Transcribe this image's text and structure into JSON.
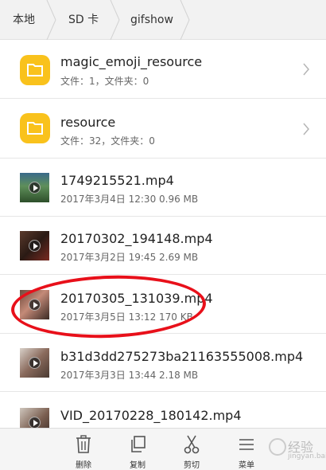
{
  "breadcrumb": {
    "items": [
      "本地",
      "SD 卡",
      "gifshow"
    ]
  },
  "files": [
    {
      "kind": "folder",
      "name": "magic_emoji_resource",
      "meta": "文件：1，文件夹：0"
    },
    {
      "kind": "folder",
      "name": "resource",
      "meta": "文件：32，文件夹：0"
    },
    {
      "kind": "video",
      "name": "1749215521.mp4",
      "meta": "2017年3月4日 12:30 0.96 MB"
    },
    {
      "kind": "video",
      "name": "20170302_194148.mp4",
      "meta": "2017年3月2日 19:45 2.69 MB"
    },
    {
      "kind": "video",
      "name": "20170305_131039.mp4",
      "meta": "2017年3月5日 13:12 170 KB"
    },
    {
      "kind": "video",
      "name": "b31d3dd275273ba21163555008.mp4",
      "meta": "2017年3月3日 13:44 2.18 MB"
    },
    {
      "kind": "video",
      "name": "VID_20170228_180142.mp4",
      "meta": ""
    }
  ],
  "toolbar": {
    "delete": "删除",
    "copy": "复制",
    "cut": "剪切",
    "menu": "菜单"
  },
  "watermark": {
    "text": "经验",
    "sub": "jingyan.baidu.com"
  },
  "colors": {
    "folder": "#f9c21c",
    "annotation": "#e8101a",
    "toolbar_bg": "#f5f5f5"
  }
}
